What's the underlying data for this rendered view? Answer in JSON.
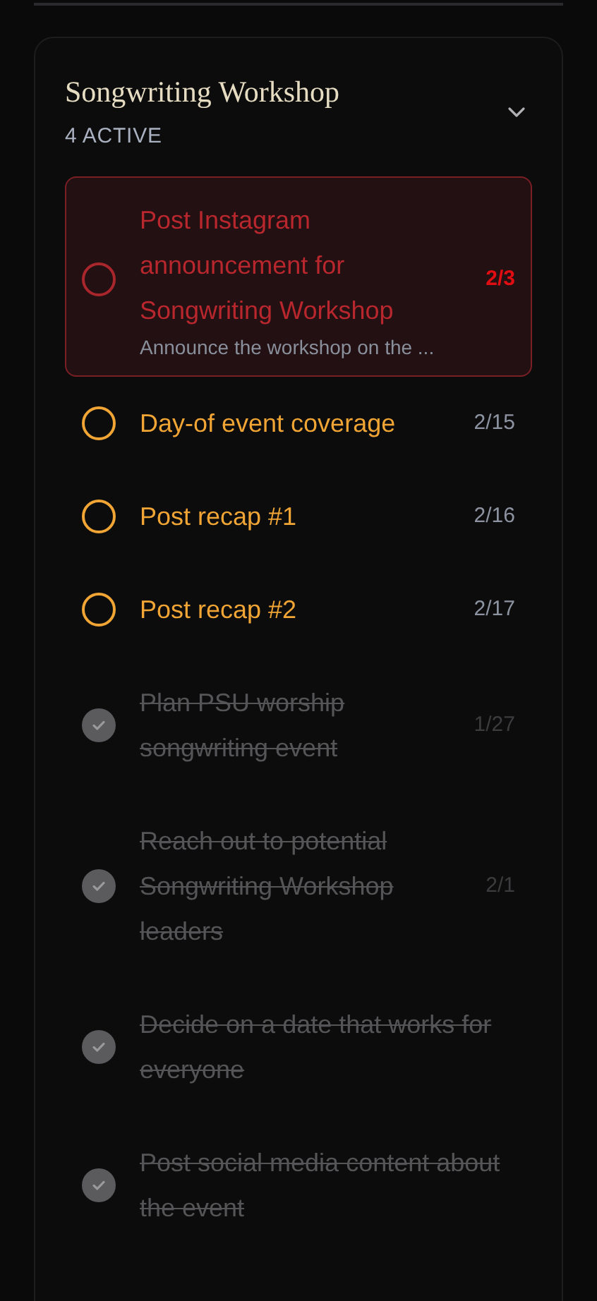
{
  "project": {
    "title": "Songwriting Workshop",
    "active_count": "4 ACTIVE",
    "expanded": true
  },
  "tasks": [
    {
      "kind": "overdue",
      "title": "Post Instagram announcement for Songwriting Workshop",
      "description": "Announce the workshop on the ...",
      "date": "2/3"
    },
    {
      "kind": "open",
      "title": "Day-of event coverage",
      "date": "2/15"
    },
    {
      "kind": "open",
      "title": "Post recap #1",
      "date": "2/16"
    },
    {
      "kind": "open",
      "title": "Post recap #2",
      "date": "2/17"
    },
    {
      "kind": "done",
      "title": "Plan PSU worship songwriting event",
      "date": "1/27"
    },
    {
      "kind": "done",
      "title": "Reach out to potential Songwriting Workshop leaders",
      "date": "2/1"
    },
    {
      "kind": "done",
      "title": "Decide on a date that works for everyone"
    },
    {
      "kind": "done",
      "title": "Post social media content about the event"
    }
  ]
}
